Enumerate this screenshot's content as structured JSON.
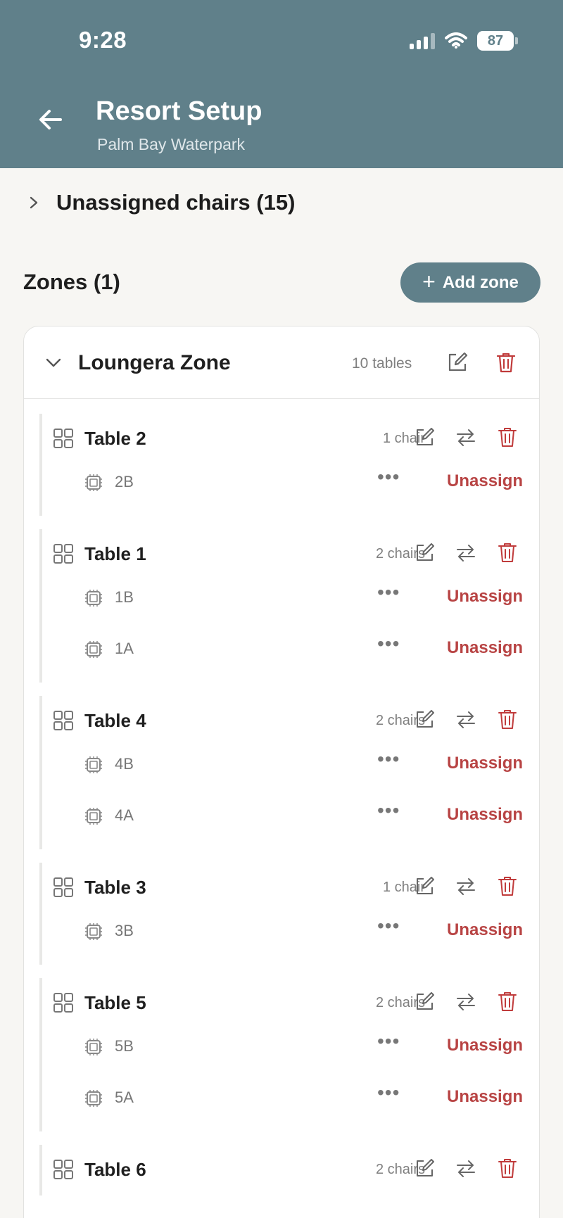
{
  "status_bar": {
    "time": "9:28",
    "battery": "87"
  },
  "header": {
    "title": "Resort Setup",
    "subtitle": "Palm Bay Waterpark"
  },
  "unassigned": {
    "label": "Unassigned chairs (15)"
  },
  "zones": {
    "title": "Zones (1)",
    "add_label": "Add zone"
  },
  "zone": {
    "name": "Loungera Zone",
    "count": "10 tables",
    "tables": [
      {
        "name": "Table 2",
        "count": "1 chair",
        "chairs": [
          {
            "label": "2B",
            "action": "Unassign"
          }
        ]
      },
      {
        "name": "Table 1",
        "count": "2 chairs",
        "chairs": [
          {
            "label": "1B",
            "action": "Unassign"
          },
          {
            "label": "1A",
            "action": "Unassign"
          }
        ]
      },
      {
        "name": "Table 4",
        "count": "2 chairs",
        "chairs": [
          {
            "label": "4B",
            "action": "Unassign"
          },
          {
            "label": "4A",
            "action": "Unassign"
          }
        ]
      },
      {
        "name": "Table 3",
        "count": "1 chair",
        "chairs": [
          {
            "label": "3B",
            "action": "Unassign"
          }
        ]
      },
      {
        "name": "Table 5",
        "count": "2 chairs",
        "chairs": [
          {
            "label": "5B",
            "action": "Unassign"
          },
          {
            "label": "5A",
            "action": "Unassign"
          }
        ]
      },
      {
        "name": "Table 6",
        "count": "2 chairs",
        "chairs": []
      }
    ]
  },
  "icons": {
    "back": "arrow-left-icon",
    "edit": "edit-icon",
    "move": "swap-arrows-icon",
    "delete": "trash-icon",
    "table": "grid-icon",
    "chair": "chip-icon",
    "more": "more-horizontal-icon"
  },
  "colors": {
    "primary": "#60808a",
    "danger": "#b84444",
    "background": "#f7f6f3"
  }
}
